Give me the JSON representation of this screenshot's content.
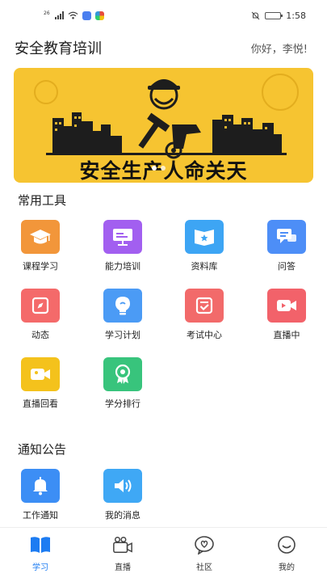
{
  "status_bar": {
    "network_label": "26",
    "time": "1:58",
    "battery_level": 0.7
  },
  "header": {
    "title": "安全教育培训",
    "greeting": "你好，李悦!"
  },
  "banner": {
    "slogan": "安全生产人命关天",
    "background_color": "#f6c431",
    "slide_count": 2,
    "active_slide": 0
  },
  "tools": {
    "title": "常用工具",
    "items": [
      {
        "label": "课程学习",
        "icon": "graduation-cap-icon",
        "color": "#f2963a"
      },
      {
        "label": "能力培训",
        "icon": "presentation-board-icon",
        "color": "#a25ff0"
      },
      {
        "label": "资料库",
        "icon": "star-book-icon",
        "color": "#3da5f4"
      },
      {
        "label": "问答",
        "icon": "chat-bubbles-icon",
        "color": "#4d8ef7"
      },
      {
        "label": "动态",
        "icon": "compass-icon",
        "color": "#f46a6a"
      },
      {
        "label": "学习计划",
        "icon": "lightbulb-icon",
        "color": "#4b9bf5"
      },
      {
        "label": "考试中心",
        "icon": "checklist-icon",
        "color": "#f26a6a"
      },
      {
        "label": "直播中",
        "icon": "video-camera-icon",
        "color": "#f2626a"
      },
      {
        "label": "直播回看",
        "icon": "video-replay-icon",
        "color": "#f4c21c"
      },
      {
        "label": "学分排行",
        "icon": "award-medal-icon",
        "color": "#38c47c"
      }
    ]
  },
  "notices": {
    "title": "通知公告",
    "items": [
      {
        "label": "工作通知",
        "icon": "bell-icon",
        "color": "#3c8ef5"
      },
      {
        "label": "我的消息",
        "icon": "speaker-icon",
        "color": "#3fa8f5"
      }
    ]
  },
  "tab_bar": {
    "items": [
      {
        "label": "学习",
        "icon": "book-icon",
        "active": true
      },
      {
        "label": "直播",
        "icon": "live-camera-icon",
        "active": false
      },
      {
        "label": "社区",
        "icon": "community-chat-icon",
        "active": false
      },
      {
        "label": "我的",
        "icon": "smile-face-icon",
        "active": false
      }
    ],
    "active_color": "#1d7cf2"
  }
}
